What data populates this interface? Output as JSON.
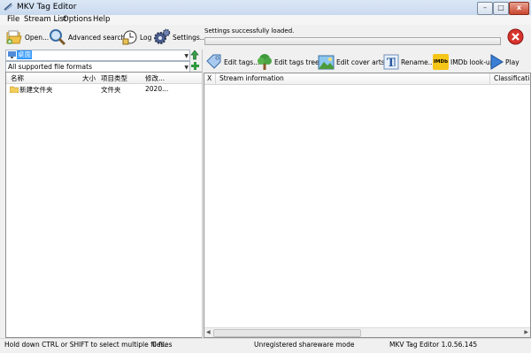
{
  "window": {
    "title": "MKV Tag Editor",
    "minimize_label": "–",
    "maximize_label": "□",
    "close_label": "x"
  },
  "menu": [
    "File",
    "Stream List",
    "Options",
    "Help"
  ],
  "left_toolbar": {
    "open_label": "Open...",
    "advanced_search_label": "Advanced search...",
    "log_label": "Log",
    "settings_label": "Settings..."
  },
  "status": {
    "message": "Settings successfully loaded.",
    "progress": 0
  },
  "left_pane": {
    "folder_value": "桌面",
    "filter_value": "All supported file formats",
    "columns": [
      "名称",
      "大小",
      "项目类型",
      "修改..."
    ],
    "rows": [
      {
        "name": "新建文件夹",
        "size": "",
        "type": "文件夹",
        "modified": "2020..."
      }
    ]
  },
  "right_toolbar": {
    "edit_tags_label": "Edit tags...",
    "edit_tags_tree_label": "Edit tags tree...",
    "edit_cover_arts_label": "Edit cover arts...",
    "rename_label": "Rename...",
    "imdb_badge": "IMDb",
    "imdb_label": "IMDb look-up",
    "play_label": "Play"
  },
  "stream_grid": {
    "columns": [
      "X",
      "Stream information",
      "Classification"
    ]
  },
  "statusbar": {
    "hint": "Hold down CTRL or SHIFT to select multiple files.",
    "file_count": "0 files",
    "license": "Unregistered shareware mode",
    "version": "MKV Tag Editor 1.0.56.145"
  },
  "colors": {
    "progress_fill": "#6cc06c",
    "selection": "#3399ff",
    "stop_red": "#d8322c",
    "imdb_yellow": "#f5c518"
  }
}
